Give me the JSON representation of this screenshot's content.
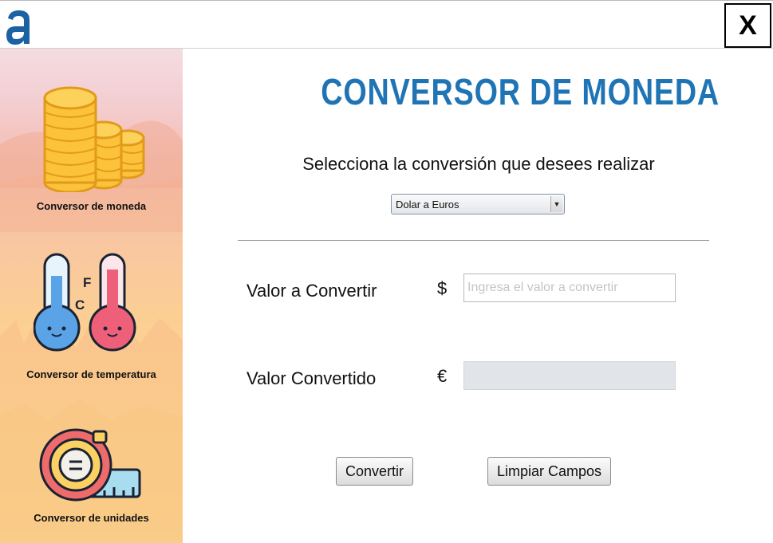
{
  "window": {
    "logo_icon": "letter-a-logo",
    "close_label": "X"
  },
  "sidebar": {
    "items": [
      {
        "label": "Conversor de moneda",
        "icon": "coins-icon"
      },
      {
        "label": "Conversor de temperatura",
        "icon": "thermometers-icon"
      },
      {
        "label": "Conversor de unidades",
        "icon": "tape-measure-icon"
      }
    ]
  },
  "main": {
    "title": "CONVERSOR DE MONEDA",
    "subtitle": "Selecciona la conversión que desees realizar",
    "conversion_select": {
      "selected": "Dolar a Euros",
      "arrow": "▼"
    },
    "input_label": "Valor a Convertir",
    "input_currency": "$",
    "input_placeholder": "Ingresa el valor a convertir",
    "input_value": "",
    "output_label": "Valor Convertido",
    "output_currency": "€",
    "output_value": "",
    "convert_button": "Convertir",
    "clear_button": "Limpiar Campos"
  },
  "colors": {
    "title_blue": "#1f74b5",
    "logo_blue": "#1b62a3"
  }
}
